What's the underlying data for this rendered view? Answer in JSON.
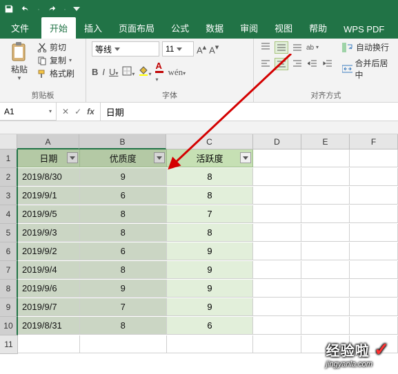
{
  "qat": {},
  "tabs": {
    "file": "文件",
    "home": "开始",
    "insert": "插入",
    "pagelayout": "页面布局",
    "formulas": "公式",
    "data": "数据",
    "review": "审阅",
    "view": "视图",
    "help": "帮助",
    "wps": "WPS PDF"
  },
  "ribbon": {
    "clipboard": {
      "paste": "粘贴",
      "cut": "剪切",
      "copy": "复制",
      "painter": "格式刷",
      "title": "剪贴板"
    },
    "font": {
      "name": "等线",
      "size": "11",
      "title": "字体"
    },
    "align": {
      "wrap": "自动换行",
      "merge": "合并后居中",
      "title": "对齐方式"
    }
  },
  "formula_bar": {
    "namebox": "A1",
    "value": "日期"
  },
  "columns": [
    "A",
    "B",
    "C",
    "D",
    "E",
    "F"
  ],
  "row_numbers": [
    "1",
    "2",
    "3",
    "4",
    "5",
    "6",
    "7",
    "8",
    "9",
    "10",
    "11"
  ],
  "headers": {
    "A": "日期",
    "B": "优质度",
    "C": "活跃度"
  },
  "chart_data": {
    "type": "table",
    "columns": [
      "日期",
      "优质度",
      "活跃度"
    ],
    "rows": [
      {
        "date": "2019/8/30",
        "q": "9",
        "a": "8"
      },
      {
        "date": "2019/9/1",
        "q": "6",
        "a": "8"
      },
      {
        "date": "2019/9/5",
        "q": "8",
        "a": "7"
      },
      {
        "date": "2019/9/3",
        "q": "8",
        "a": "8"
      },
      {
        "date": "2019/9/2",
        "q": "6",
        "a": "9"
      },
      {
        "date": "2019/9/4",
        "q": "8",
        "a": "9"
      },
      {
        "date": "2019/9/6",
        "q": "9",
        "a": "9"
      },
      {
        "date": "2019/9/7",
        "q": "7",
        "a": "9"
      },
      {
        "date": "2019/8/31",
        "q": "8",
        "a": "6"
      }
    ]
  },
  "watermark": {
    "text": "经验啦",
    "url": "jingyanla.com"
  }
}
